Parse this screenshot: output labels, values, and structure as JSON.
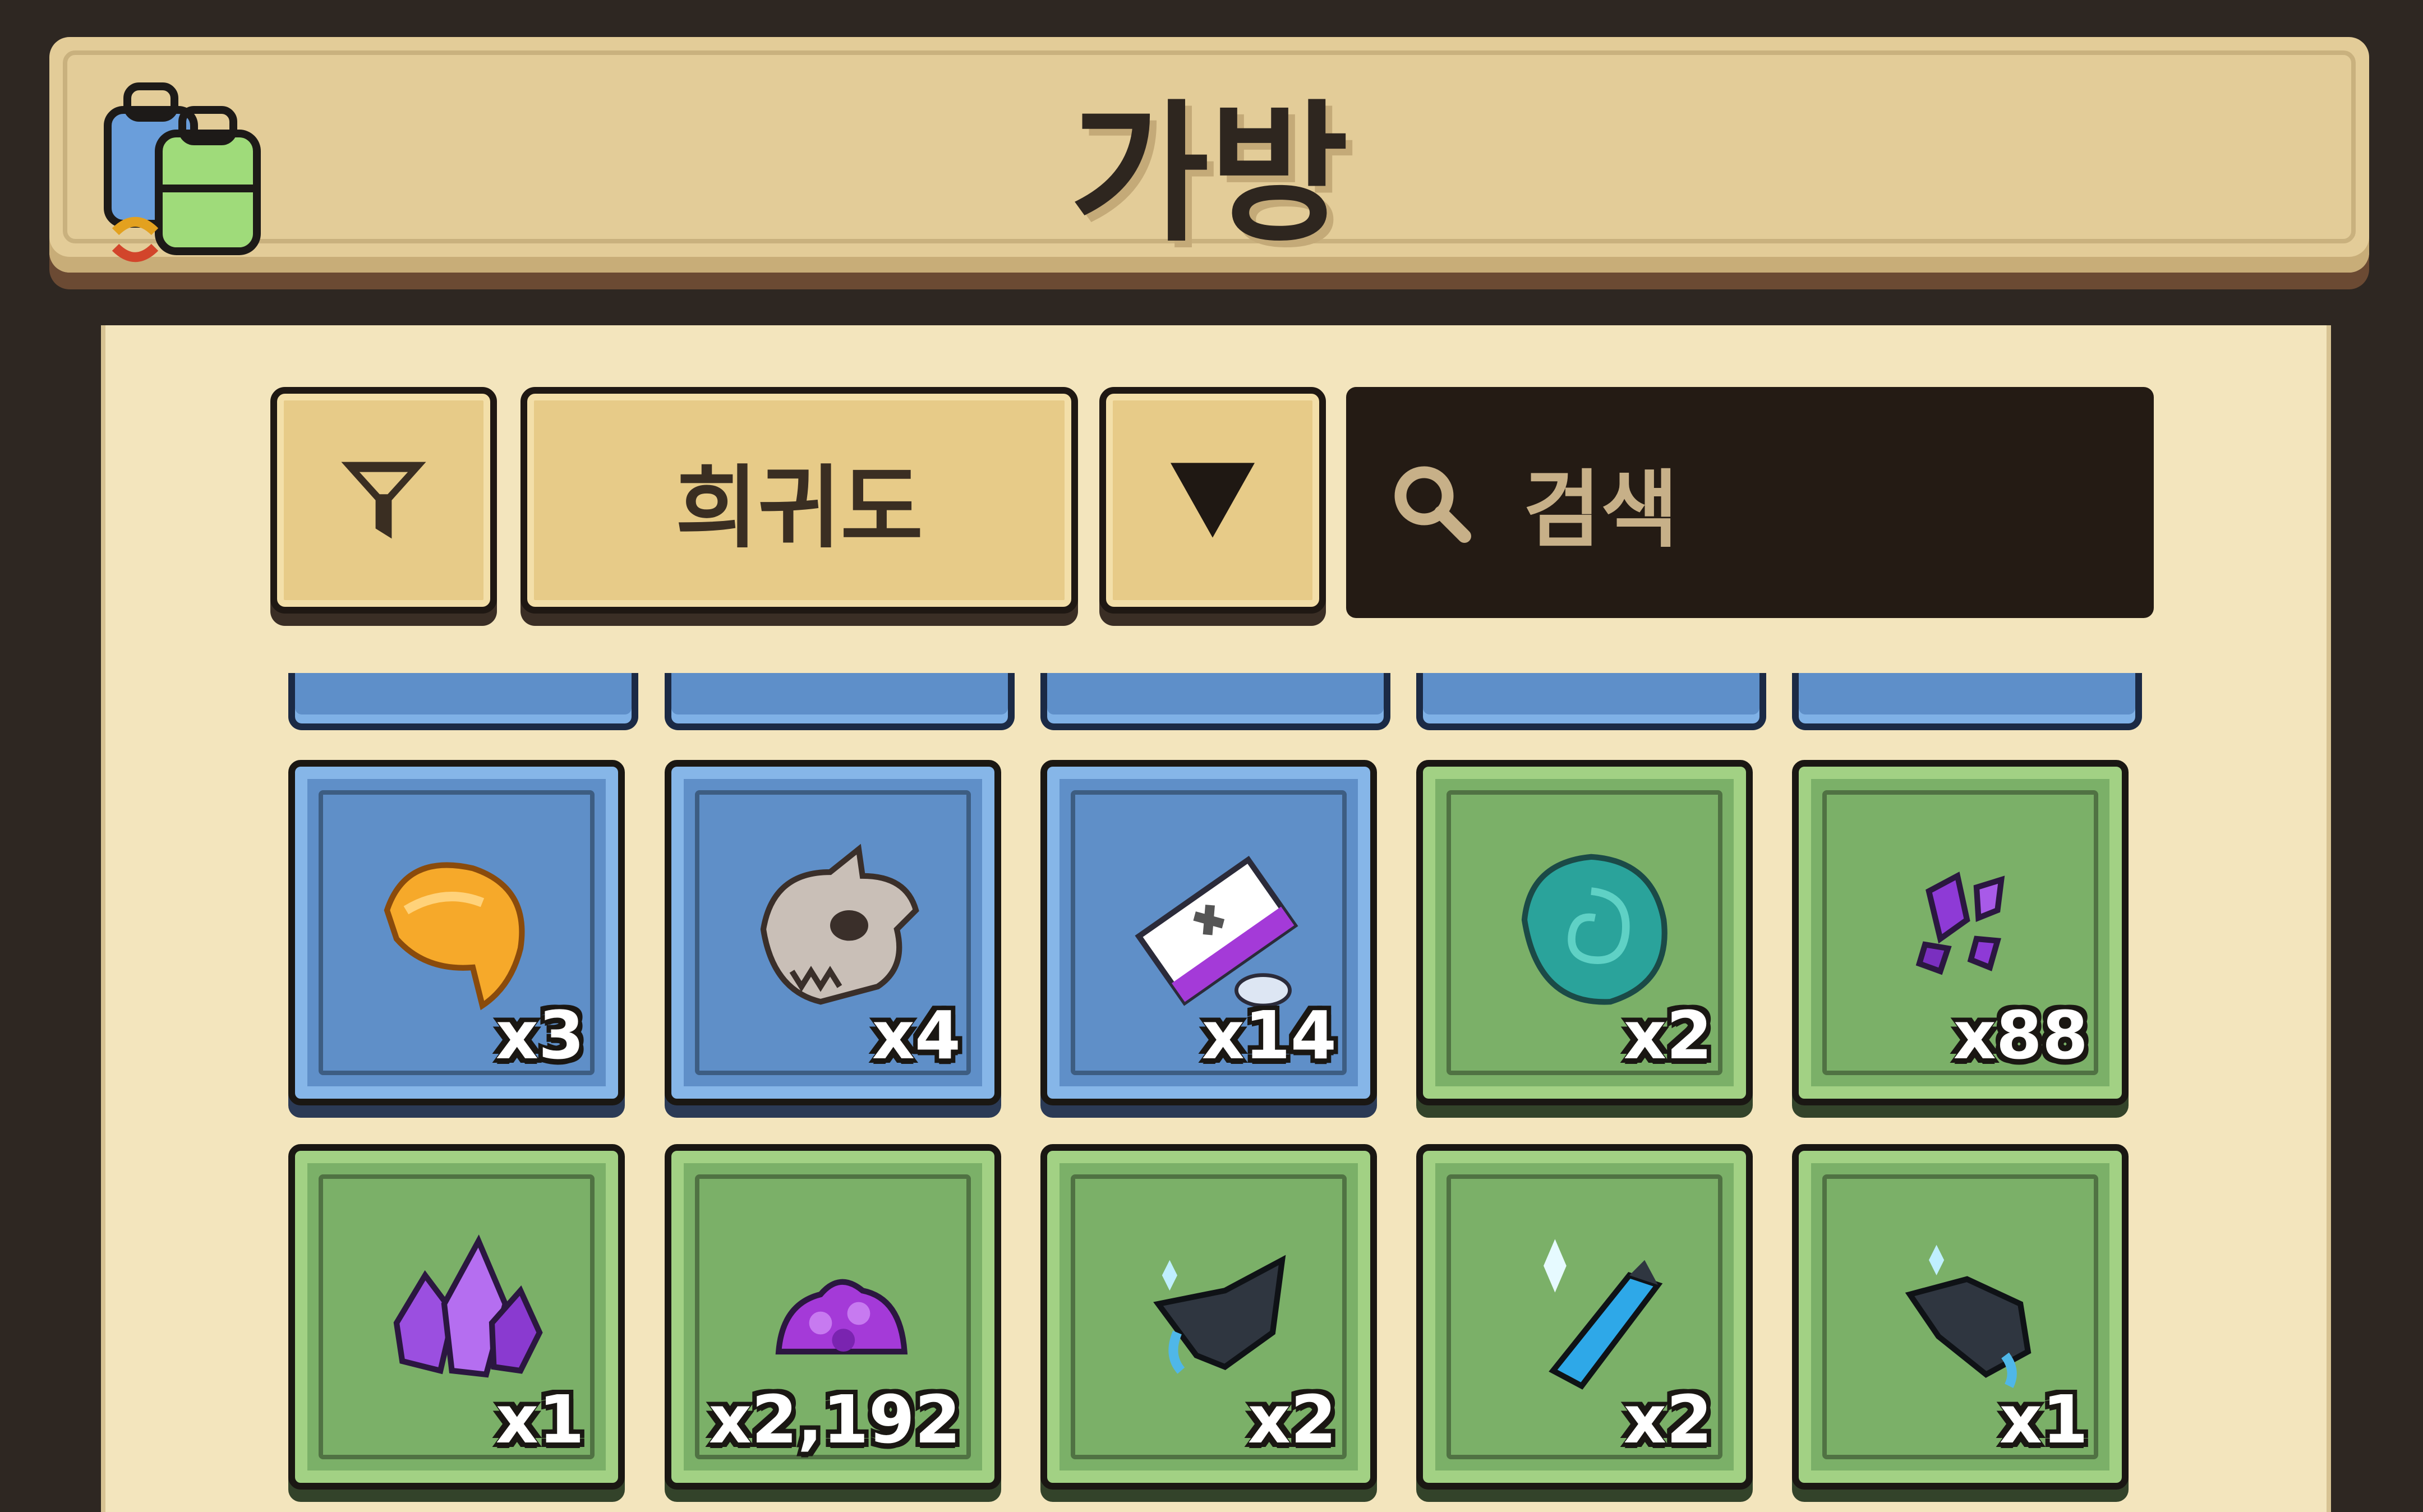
{
  "header": {
    "title": "가방",
    "bag_icon": "backpack-swap-icon"
  },
  "toolbar": {
    "filter_icon": "filter-icon",
    "sort_label": "희귀도",
    "order_icon": "triangle-down-icon",
    "search_icon": "search-icon",
    "search_placeholder": "검색"
  },
  "items": [
    {
      "rarity": "blue",
      "icon": "golden-leaf-icon",
      "qty": "x3"
    },
    {
      "rarity": "blue",
      "icon": "dragon-skull-icon",
      "qty": "x4"
    },
    {
      "rarity": "blue",
      "icon": "ticket-icon",
      "qty": "x14"
    },
    {
      "rarity": "green",
      "icon": "teal-fossil-icon",
      "qty": "x2"
    },
    {
      "rarity": "green",
      "icon": "purple-shards-icon",
      "qty": "x88"
    },
    {
      "rarity": "green",
      "icon": "amethyst-crystal-icon",
      "qty": "x1"
    },
    {
      "rarity": "green",
      "icon": "purple-ore-pile-icon",
      "qty": "x2,192"
    },
    {
      "rarity": "green",
      "icon": "dark-scrap-icon",
      "qty": "x2"
    },
    {
      "rarity": "green",
      "icon": "blue-shard-icon",
      "qty": "x2"
    },
    {
      "rarity": "green",
      "icon": "dark-scrap-icon",
      "qty": "x1"
    }
  ],
  "colors": {
    "blue_slot": "#5f8fc8",
    "green_slot": "#7bb068",
    "panel": "#f3e5bd",
    "header": "#e3cc98"
  }
}
